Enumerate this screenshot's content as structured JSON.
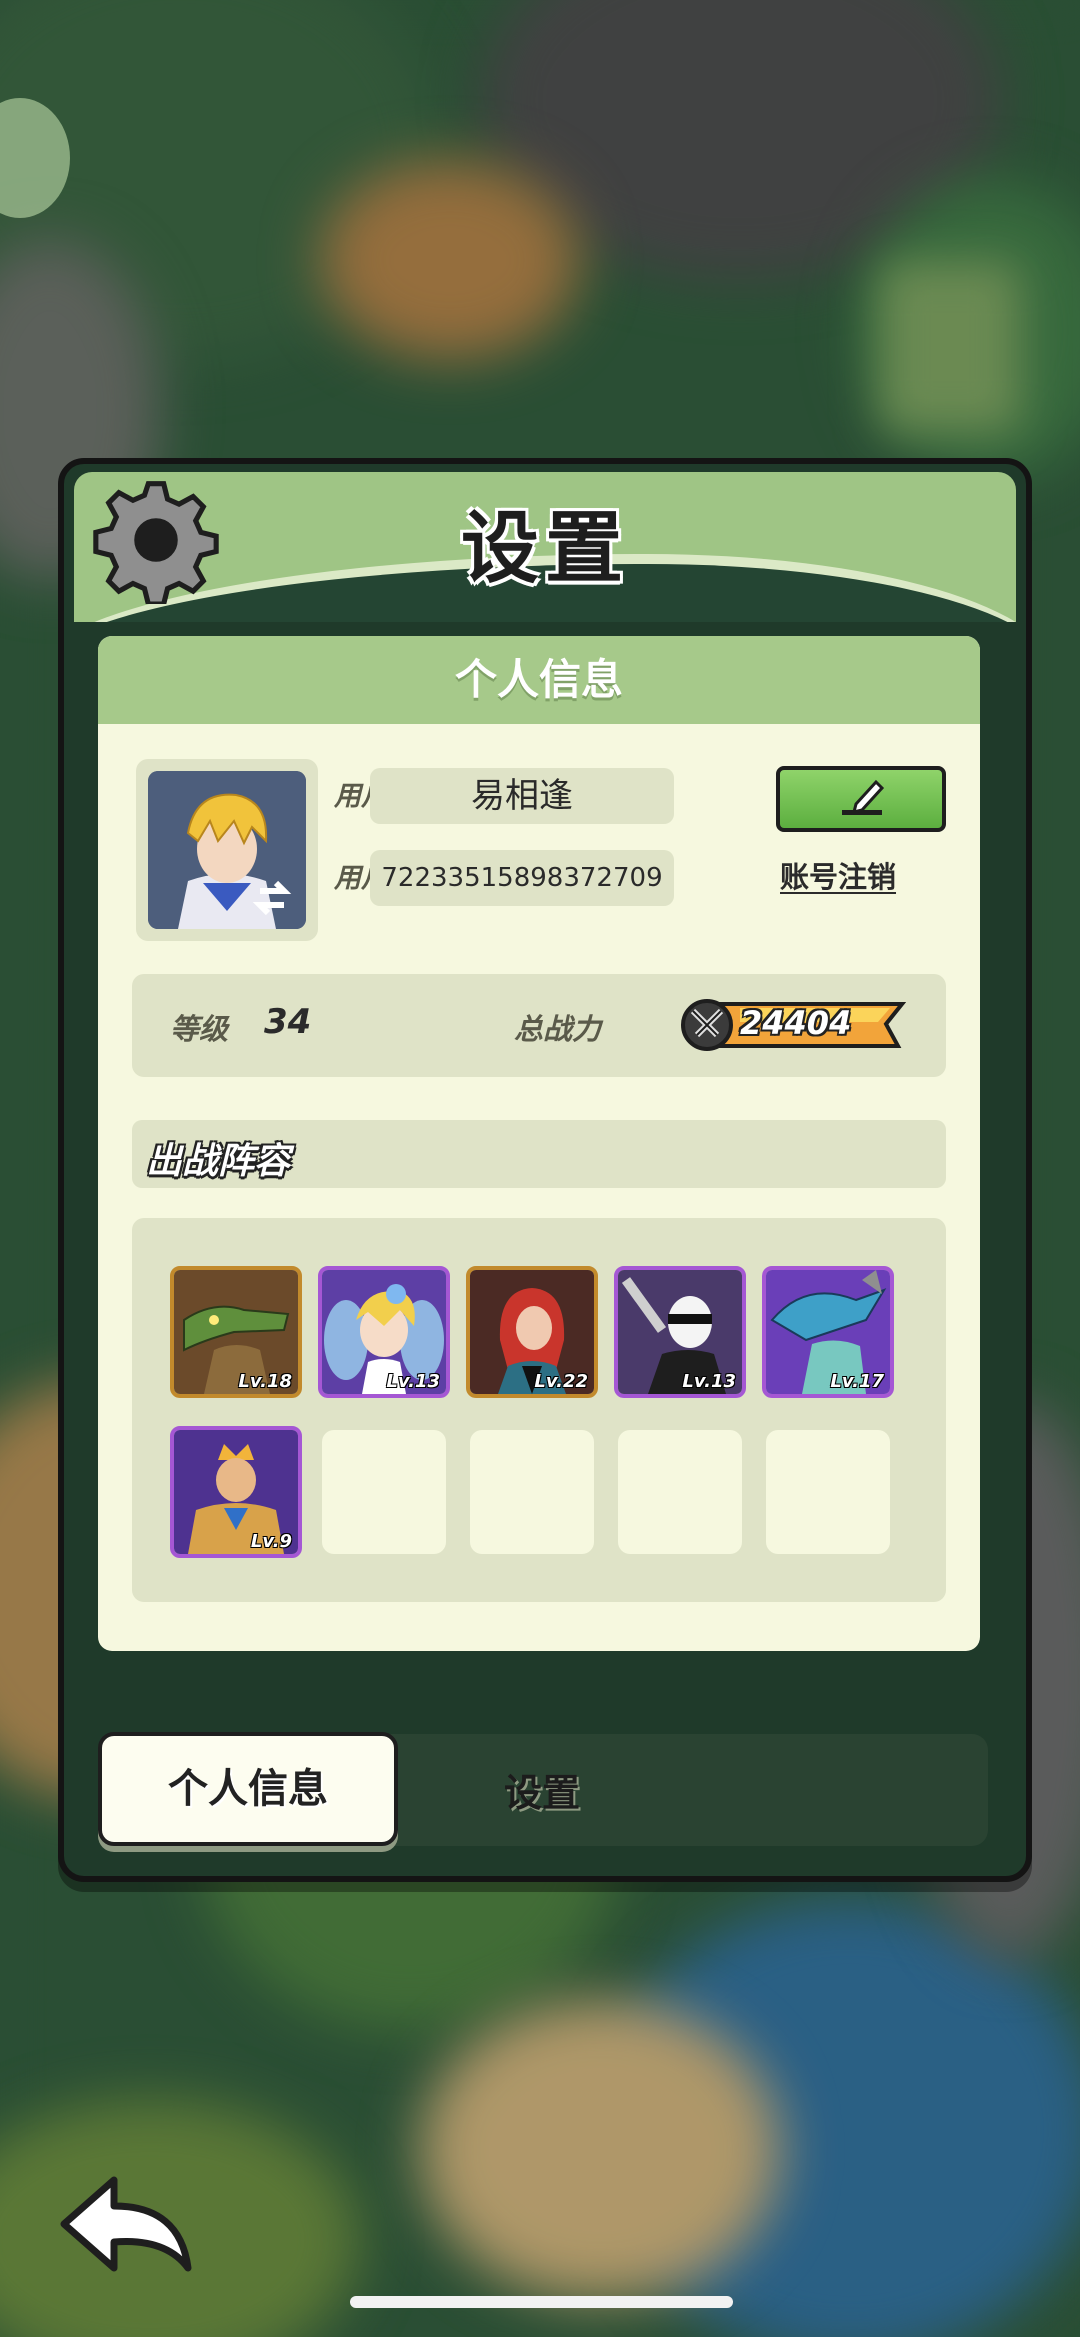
{
  "dialog": {
    "title": "设置",
    "panel_title": "个人信息"
  },
  "profile": {
    "nickname_label": "用户昵称",
    "nickname": "易相逢",
    "id_label": "用户  ID",
    "user_id": "72233515898372709",
    "cancel_account": "账号注销"
  },
  "stats": {
    "level_label": "等级",
    "level": "34",
    "power_label": "总战力",
    "power": "24404"
  },
  "lineup": {
    "title": "出战阵容",
    "heroes": [
      {
        "level": "Lv.18",
        "rarity": "gold",
        "icon": "crocodile-hero-icon"
      },
      {
        "level": "Lv.13",
        "rarity": "purple",
        "icon": "fairy-hero-icon"
      },
      {
        "level": "Lv.22",
        "rarity": "gold",
        "icon": "redhair-hero-icon"
      },
      {
        "level": "Lv.13",
        "rarity": "purple",
        "icon": "android-hero-icon"
      },
      {
        "level": "Lv.17",
        "rarity": "purple",
        "icon": "shark-hero-icon"
      },
      {
        "level": "Lv.9",
        "rarity": "purple",
        "icon": "king-hero-icon"
      }
    ],
    "empty_slots": 4
  },
  "tabs": {
    "active": "个人信息",
    "other": "设置"
  },
  "colors": {
    "header_green": "#9fc585",
    "panel_bg": "#f6f8df",
    "edit_button": "#6cc04a",
    "gold_frame": "#c28a2c",
    "purple_frame": "#a557d4"
  }
}
